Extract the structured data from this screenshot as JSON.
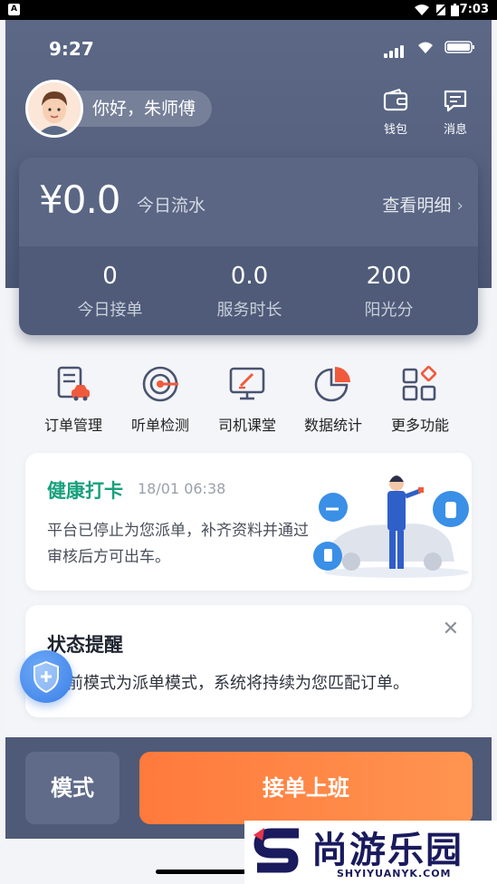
{
  "android_status": {
    "app_badge": "A",
    "time": "7:03"
  },
  "ios_status": {
    "time": "9:27"
  },
  "header": {
    "greeting": "你好，朱师傅",
    "wallet_label": "钱包",
    "messages_label": "消息"
  },
  "earnings": {
    "amount": "¥0.0",
    "amount_label": "今日流水",
    "detail_label": "查看明细",
    "stats": [
      {
        "value": "0",
        "label": "今日接单"
      },
      {
        "value": "0.0",
        "label": "服务时长"
      },
      {
        "value": "200",
        "label": "阳光分"
      }
    ]
  },
  "menu": [
    {
      "label": "订单管理",
      "icon": "order-icon"
    },
    {
      "label": "听单检测",
      "icon": "target-icon"
    },
    {
      "label": "司机课堂",
      "icon": "classroom-icon"
    },
    {
      "label": "数据统计",
      "icon": "pie-chart-icon"
    },
    {
      "label": "更多功能",
      "icon": "grid-icon"
    }
  ],
  "health": {
    "title": "健康打卡",
    "time": "18/01 06:38",
    "text": "平台已停止为您派单，补齐资料并通过审核后方可出车。"
  },
  "status": {
    "title": "状态提醒",
    "close": "✕",
    "text": "前模式为派单模式，系统将持续为您匹配订单。"
  },
  "bottom": {
    "mode_label": "模式",
    "go_label": "接单上班"
  },
  "watermark": {
    "text": "尚游乐园",
    "sub": "SHYIYUANYK.COM"
  },
  "colors": {
    "header": "#55617f",
    "accent_green": "#17a07c",
    "accent_orange": "#ff7a3c",
    "icon_red": "#f05a3c"
  }
}
